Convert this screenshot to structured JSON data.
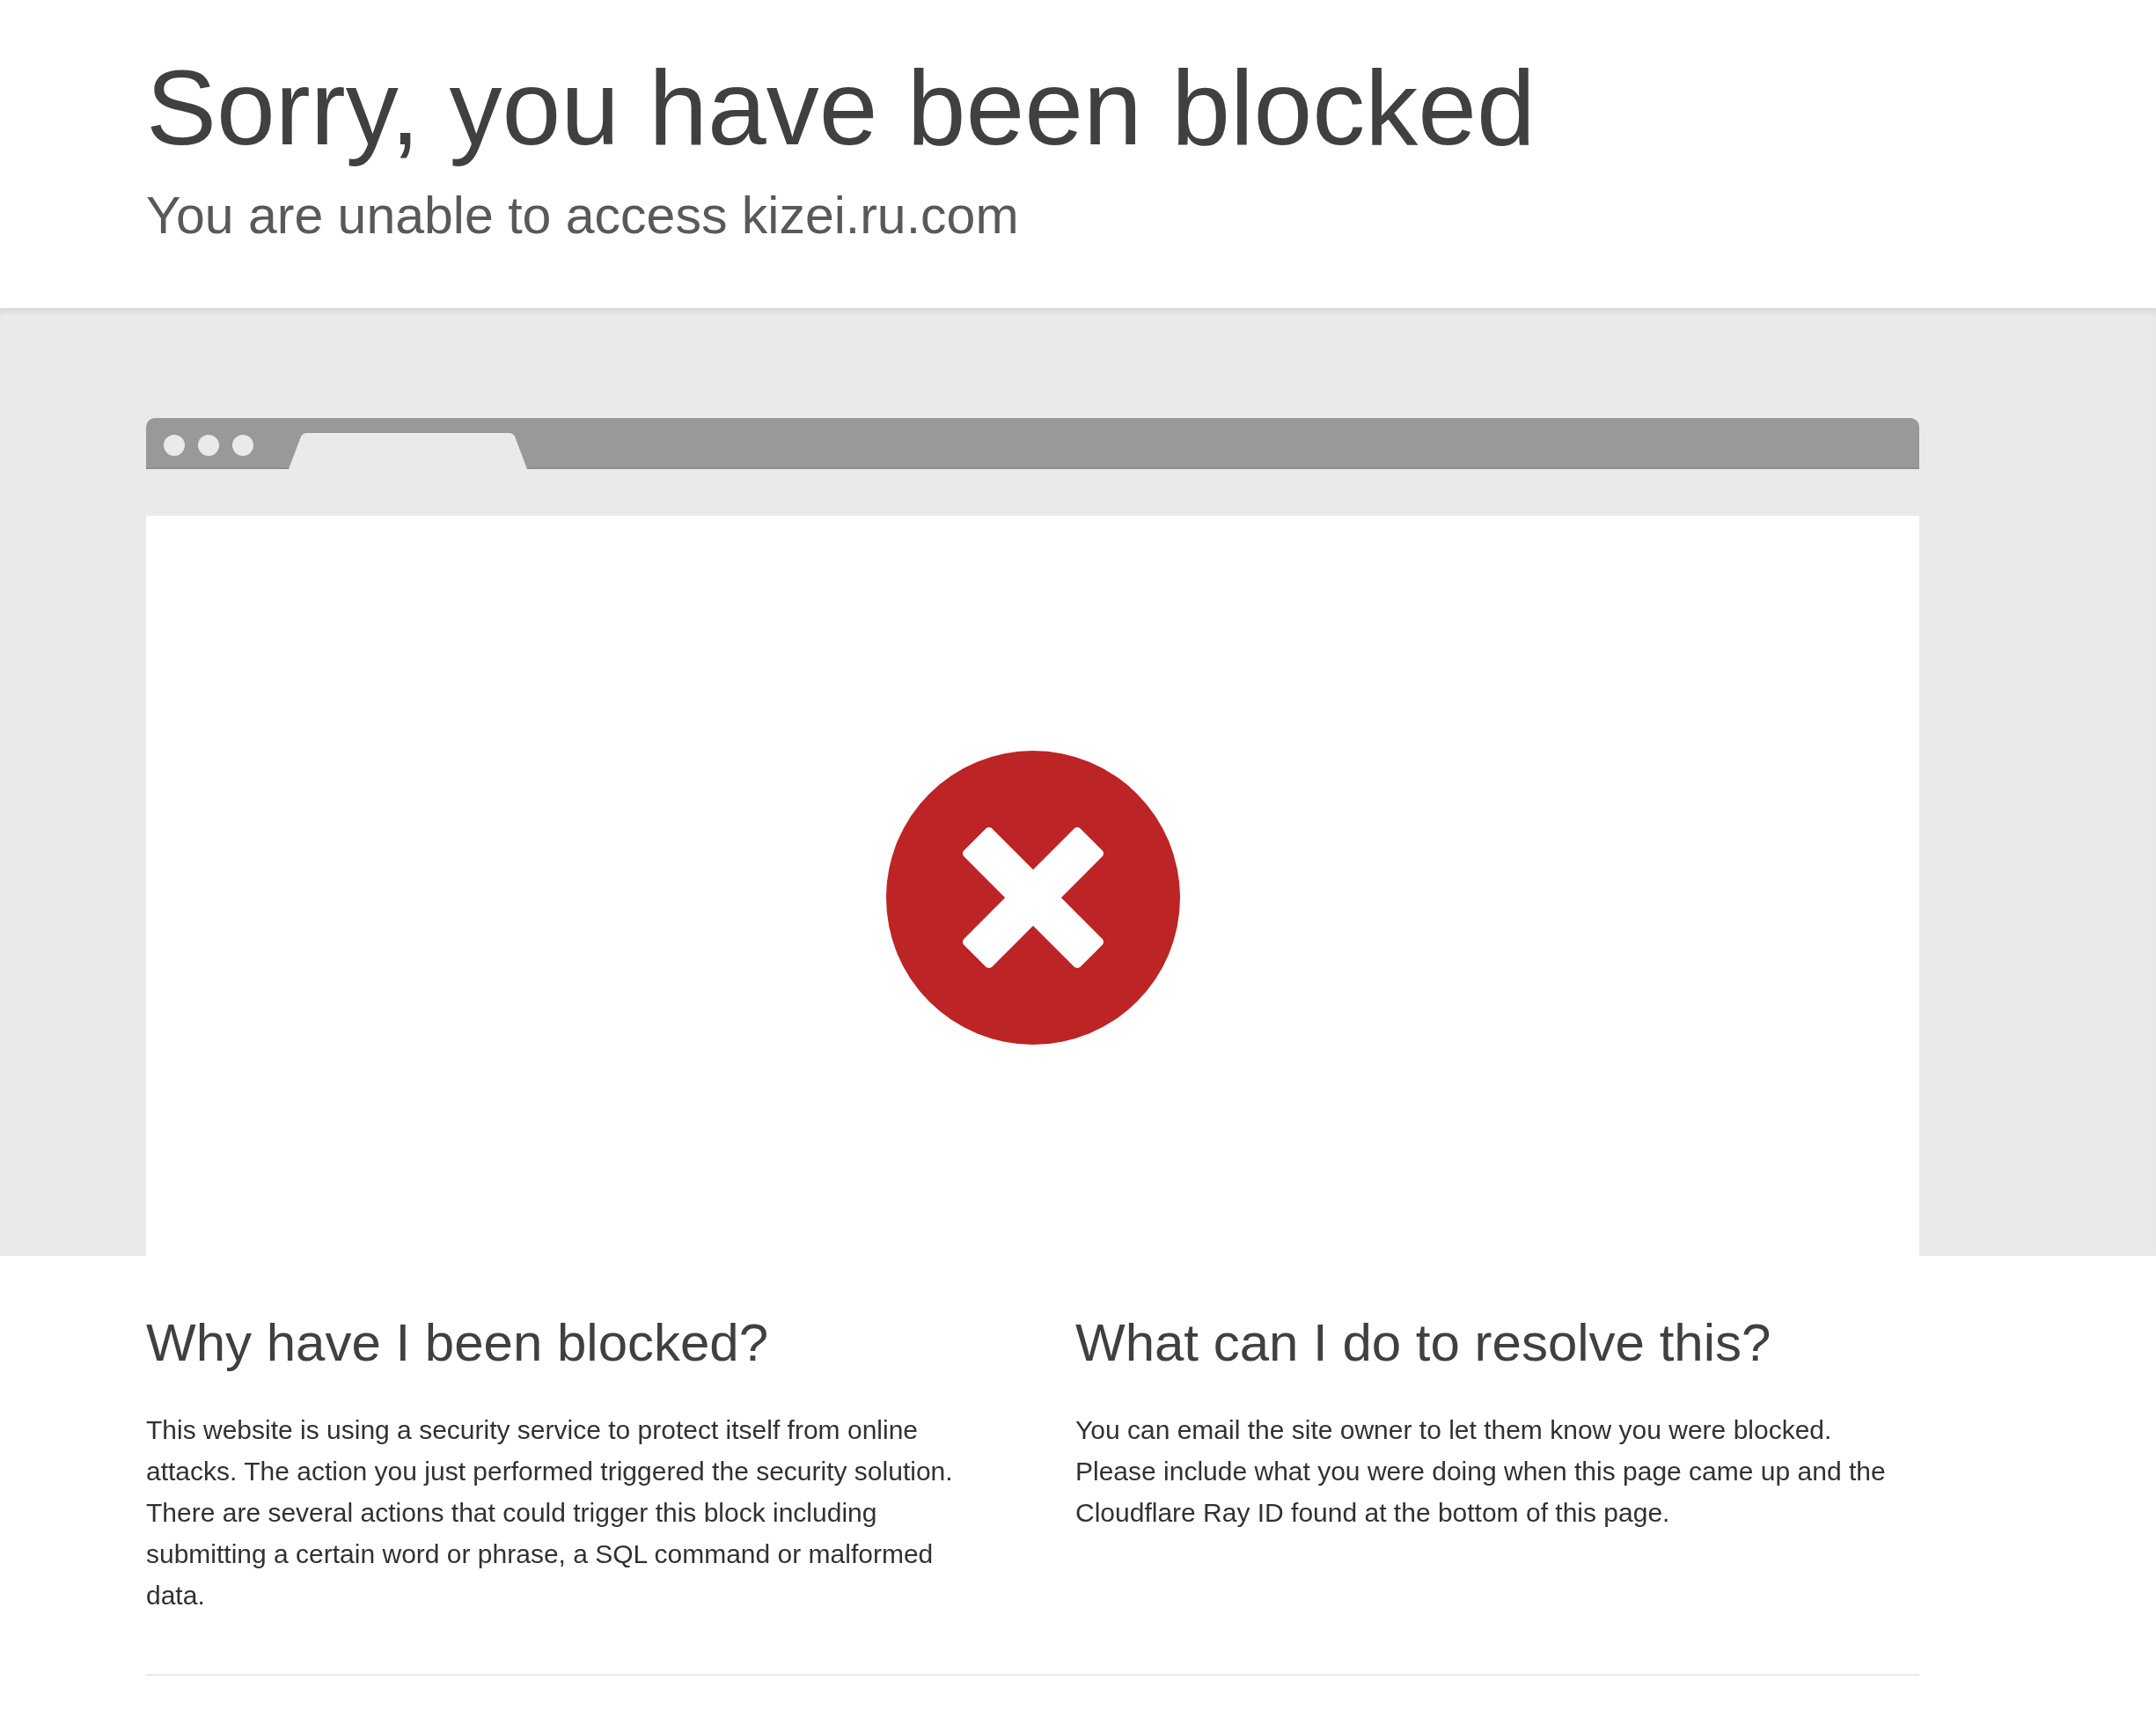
{
  "header": {
    "title": "Sorry, you have been blocked",
    "subtitle": "You are unable to access kizei.ru.com"
  },
  "sections": [
    {
      "heading": "Why have I been blocked?",
      "body": "This website is using a security service to protect itself from online attacks. The action you just performed triggered the security solution. There are several actions that could trigger this block including submitting a certain word or phrase, a SQL command or malformed data."
    },
    {
      "heading": "What can I do to resolve this?",
      "body": "You can email the site owner to let them know you were blocked. Please include what you were doing when this page came up and the Cloudflare Ray ID found at the bottom of this page."
    }
  ]
}
